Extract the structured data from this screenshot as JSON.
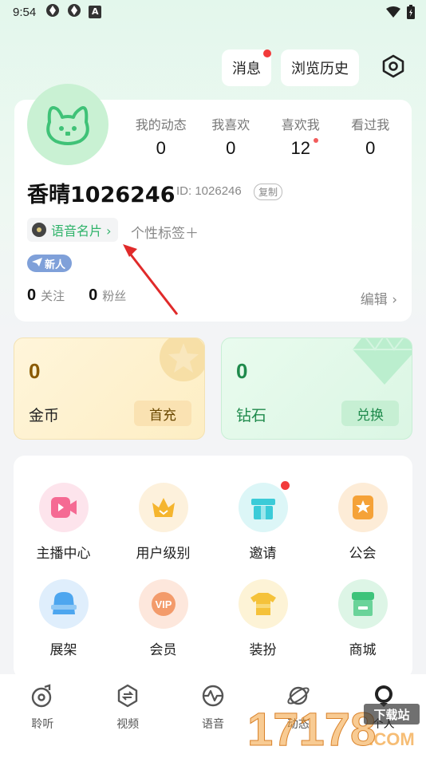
{
  "status_bar": {
    "time": "9:54",
    "badge": "A"
  },
  "header": {
    "messages_label": "消息",
    "history_label": "浏览历史"
  },
  "profile": {
    "stats": [
      {
        "label": "我的动态",
        "value": "0"
      },
      {
        "label": "我喜欢",
        "value": "0"
      },
      {
        "label": "喜欢我",
        "value": "12"
      },
      {
        "label": "看过我",
        "value": "0"
      }
    ],
    "nickname": "香晴1026246",
    "id_text": "ID: 1026246",
    "copy_label": "复制",
    "voice_card_label": "语音名片 ›",
    "tag_add_label": "个性标签＋",
    "badge_new": "新人",
    "following_count": "0",
    "following_label": "关注",
    "fans_count": "0",
    "fans_label": "粉丝",
    "edit_label": "编辑 ›"
  },
  "wallet": {
    "coins": {
      "value": "0",
      "name": "金币",
      "action": "首充"
    },
    "diamonds": {
      "value": "0",
      "name": "钻石",
      "action": "兑换"
    }
  },
  "services": [
    {
      "label": "主播中心",
      "icon": "camera-icon",
      "color": "#f56a93"
    },
    {
      "label": "用户级别",
      "icon": "crown-icon",
      "color": "#f5b52e"
    },
    {
      "label": "邀请",
      "icon": "gift-icon",
      "color": "#3bcbd8"
    },
    {
      "label": "公会",
      "icon": "guild-icon",
      "color": "#f5a238"
    },
    {
      "label": "展架",
      "icon": "bag-icon",
      "color": "#4da6ef"
    },
    {
      "label": "会员",
      "icon": "vip-icon",
      "color": "#f39b6b"
    },
    {
      "label": "装扮",
      "icon": "shirt-icon",
      "color": "#f5c23a"
    },
    {
      "label": "商城",
      "icon": "shop-icon",
      "color": "#3dc37a"
    }
  ],
  "tabs": [
    {
      "label": "聆听",
      "icon": "listen-icon"
    },
    {
      "label": "视频",
      "icon": "video-icon"
    },
    {
      "label": "语音",
      "icon": "voice-icon"
    },
    {
      "label": "动态",
      "icon": "planet-icon"
    },
    {
      "label": "个人",
      "icon": "profile-icon"
    }
  ],
  "watermark": {
    "text": "17178",
    "sub": "下载站",
    "domain": ".COM"
  },
  "colors": {
    "accent": "#2fb36a",
    "red_dot": "#f23a3a",
    "arrow": "#e02a2a"
  }
}
